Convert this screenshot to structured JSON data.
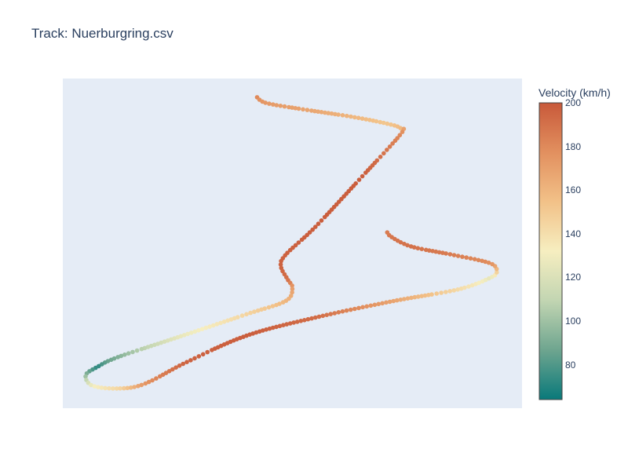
{
  "title": "Track: Nuerburgring.csv",
  "chart_data": {
    "type": "scatter",
    "title": "Track: Nuerburgring.csv",
    "xlabel": "",
    "ylabel": "",
    "grid": false,
    "colorbar": {
      "title": "Velocity (km/h)",
      "range": [
        64,
        200
      ],
      "ticks": [
        80,
        100,
        120,
        140,
        160,
        180,
        200
      ],
      "colorscale": [
        "#09797a",
        "#6ea58f",
        "#c2d5b2",
        "#f6eec0",
        "#f2c188",
        "#e2905f",
        "#c8593a"
      ]
    },
    "xlim": [
      0,
      100
    ],
    "ylim": [
      0,
      100
    ],
    "path": [
      {
        "x": 42.3,
        "y": 94.3,
        "v": 180
      },
      {
        "x": 44.5,
        "y": 92.5,
        "v": 173
      },
      {
        "x": 53.0,
        "y": 90.5,
        "v": 168
      },
      {
        "x": 62.5,
        "y": 88.5,
        "v": 160
      },
      {
        "x": 70.0,
        "y": 86.5,
        "v": 152
      },
      {
        "x": 73.5,
        "y": 85.0,
        "v": 158
      },
      {
        "x": 73.5,
        "y": 83.0,
        "v": 180
      },
      {
        "x": 65.0,
        "y": 70.0,
        "v": 198
      },
      {
        "x": 55.0,
        "y": 55.0,
        "v": 198
      },
      {
        "x": 48.5,
        "y": 46.5,
        "v": 196
      },
      {
        "x": 47.5,
        "y": 43.0,
        "v": 196
      },
      {
        "x": 49.0,
        "y": 39.0,
        "v": 190
      },
      {
        "x": 50.0,
        "y": 36.5,
        "v": 172
      },
      {
        "x": 48.5,
        "y": 32.5,
        "v": 160
      },
      {
        "x": 40.0,
        "y": 28.5,
        "v": 145
      },
      {
        "x": 25.0,
        "y": 21.5,
        "v": 125
      },
      {
        "x": 12.0,
        "y": 15.5,
        "v": 92
      },
      {
        "x": 7.5,
        "y": 12.5,
        "v": 72
      },
      {
        "x": 5.0,
        "y": 10.0,
        "v": 95
      },
      {
        "x": 6.5,
        "y": 6.8,
        "v": 130
      },
      {
        "x": 12.5,
        "y": 6.0,
        "v": 145
      },
      {
        "x": 18.0,
        "y": 7.5,
        "v": 175
      },
      {
        "x": 27.0,
        "y": 14.0,
        "v": 196
      },
      {
        "x": 40.0,
        "y": 22.0,
        "v": 198
      },
      {
        "x": 55.0,
        "y": 27.5,
        "v": 192
      },
      {
        "x": 72.0,
        "y": 32.5,
        "v": 168
      },
      {
        "x": 86.0,
        "y": 36.0,
        "v": 142
      },
      {
        "x": 93.0,
        "y": 39.5,
        "v": 125
      },
      {
        "x": 94.5,
        "y": 41.5,
        "v": 150
      },
      {
        "x": 93.0,
        "y": 44.0,
        "v": 178
      },
      {
        "x": 85.0,
        "y": 46.5,
        "v": 185
      },
      {
        "x": 76.0,
        "y": 49.0,
        "v": 190
      },
      {
        "x": 71.5,
        "y": 52.0,
        "v": 188
      },
      {
        "x": 70.5,
        "y": 53.8,
        "v": 184
      }
    ]
  }
}
